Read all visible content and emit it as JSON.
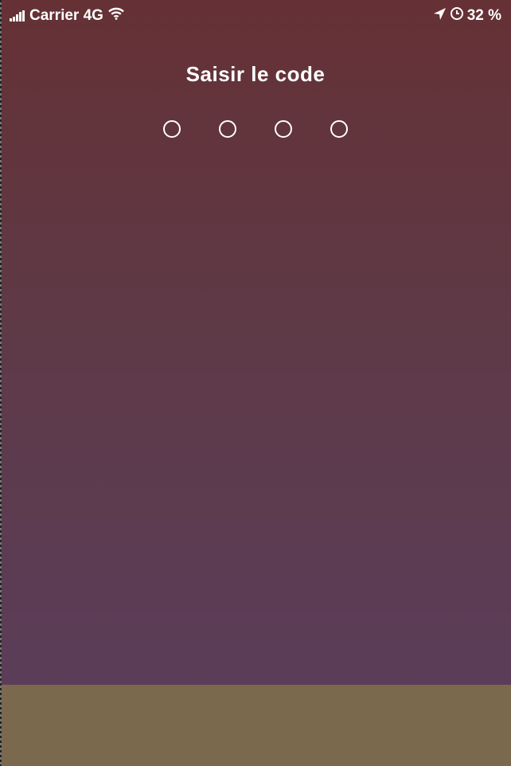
{
  "status_bar": {
    "carrier": "Carrier 4G",
    "battery": "32 %",
    "icons": [
      "signal-icon",
      "wifi-icon",
      "location-arrow-icon",
      "alarm-clock-icon"
    ]
  },
  "passcode": {
    "title": "Saisir le code",
    "digits_total": 4,
    "digits_entered": 0
  },
  "colors": {
    "background_top": "#653135",
    "background_bottom": "#5b3e5d",
    "bottom_panel": "#7b694d",
    "text": "#ffffff"
  }
}
